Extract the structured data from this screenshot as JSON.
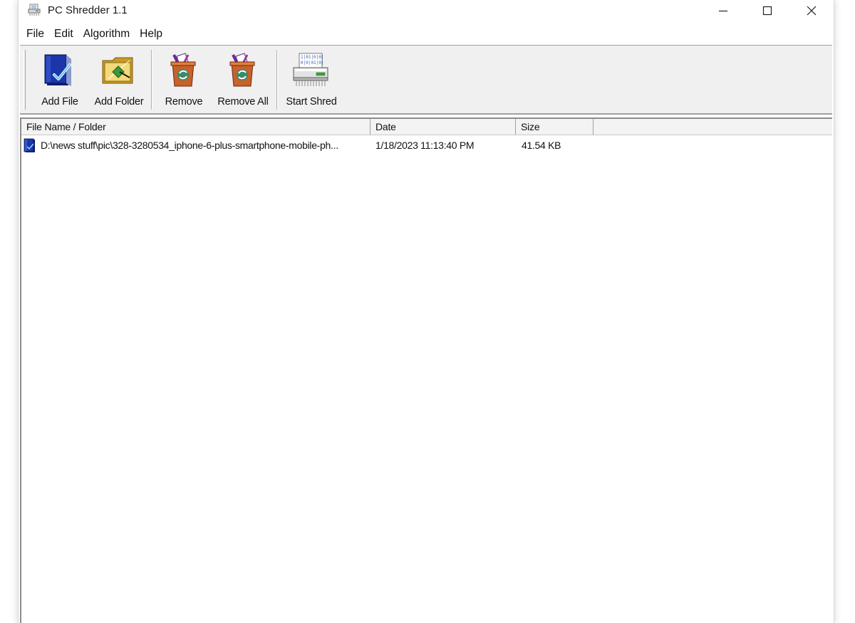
{
  "window": {
    "title": "PC Shredder 1.1",
    "controls": {
      "minimize": "—",
      "maximize": "☐",
      "close": "✕"
    }
  },
  "menu": [
    {
      "label": "File"
    },
    {
      "label": "Edit"
    },
    {
      "label": "Algorithm"
    },
    {
      "label": "Help"
    }
  ],
  "toolbar": {
    "add_file": {
      "label": "Add File",
      "icon": "add-file-icon"
    },
    "add_folder": {
      "label": "Add Folder",
      "icon": "add-folder-icon"
    },
    "remove": {
      "label": "Remove",
      "icon": "recycle-bin-icon"
    },
    "remove_all": {
      "label": "Remove All",
      "icon": "recycle-bin-icon"
    },
    "start_shred": {
      "label": "Start Shred",
      "icon": "shredder-icon"
    }
  },
  "list": {
    "columns": [
      "File Name / Folder",
      "Date",
      "Size"
    ],
    "rows": [
      {
        "name": "D:\\news stuff\\pic\\328-3280534_iphone-6-plus-smartphone-mobile-ph...",
        "date": "1/18/2023 11:13:40 PM",
        "size": "41.54 KB",
        "icon": "file-icon"
      }
    ]
  },
  "colors": {
    "toolbar_bg": "#f0f0f0",
    "list_bg": "#ffffff",
    "file_icon_blue": "#1c2f8c",
    "folder_gold": "#d4a72c",
    "bin_orange": "#c8612a",
    "ribbon_purple": "#6a2a9a"
  }
}
